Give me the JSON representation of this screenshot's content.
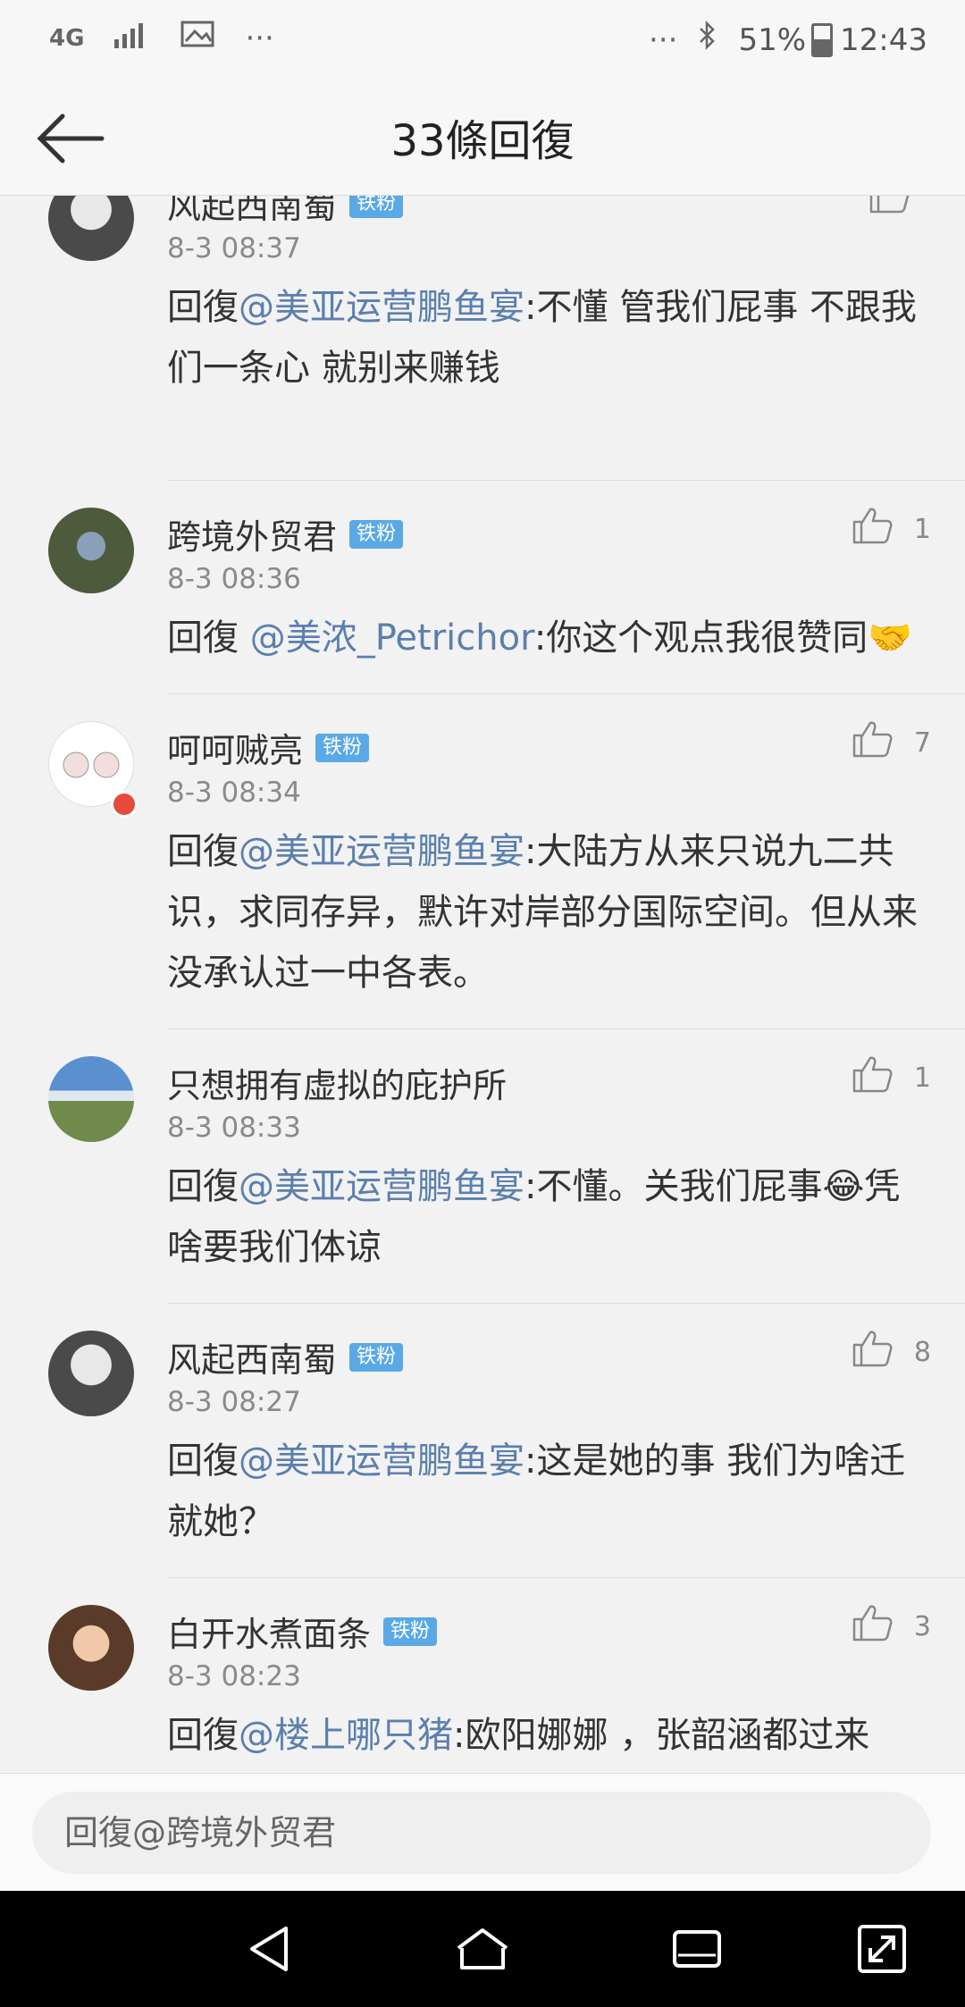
{
  "status_bar": {
    "network": "4G",
    "battery": "51%",
    "time": "12:43",
    "dots": "···",
    "icons": [
      "network-4g-icon",
      "signal-icon",
      "image-icon",
      "more-dots-icon",
      "bluetooth-icon",
      "battery-icon"
    ]
  },
  "header": {
    "title": "33條回復"
  },
  "comments": [
    {
      "name": "风起西南蜀",
      "badge": "铁粉",
      "time": "8-3 08:37",
      "likes": "",
      "prefix": "回復",
      "mention": "@美亚运营鹏鱼宴",
      "body": ":不懂 管我们屁事 不跟我们一条心 就别来赚钱"
    },
    {
      "name": "跨境外贸君",
      "badge": "铁粉",
      "time": "8-3 08:36",
      "likes": "1",
      "prefix": "回復 ",
      "mention": "@美浓_Petrichor",
      "body": ":你这个观点我很赞同🤝"
    },
    {
      "name": "呵呵贼亮",
      "badge": "铁粉",
      "time": "8-3 08:34",
      "likes": "7",
      "prefix": "回復",
      "mention": "@美亚运营鹏鱼宴",
      "body": ":大陆方从来只说九二共识，求同存异，默许对岸部分国际空间。但从来没承认过一中各表。"
    },
    {
      "name": "只想拥有虚拟的庇护所",
      "badge": "",
      "time": "8-3 08:33",
      "likes": "1",
      "prefix": "回復",
      "mention": "@美亚运营鹏鱼宴",
      "body": ":不懂。关我们屁事😂凭啥要我们体谅"
    },
    {
      "name": "风起西南蜀",
      "badge": "铁粉",
      "time": "8-3 08:27",
      "likes": "8",
      "prefix": "回復",
      "mention": "@美亚运营鹏鱼宴",
      "body": ":这是她的事 我们为啥迁就她？"
    },
    {
      "name": "白开水煮面条",
      "badge": "铁粉",
      "time": "8-3 08:23",
      "likes": "3",
      "prefix": "回復",
      "mention": "@楼上哪只猪",
      "body": ":欧阳娜娜 ，张韶涵都过来了，她姐俩就想又当又立？"
    }
  ],
  "reply": {
    "placeholder": "回復@跨境外贸君"
  },
  "nav": {
    "icons": [
      "back-triangle-icon",
      "home-icon",
      "recents-icon",
      "expand-icon"
    ]
  }
}
